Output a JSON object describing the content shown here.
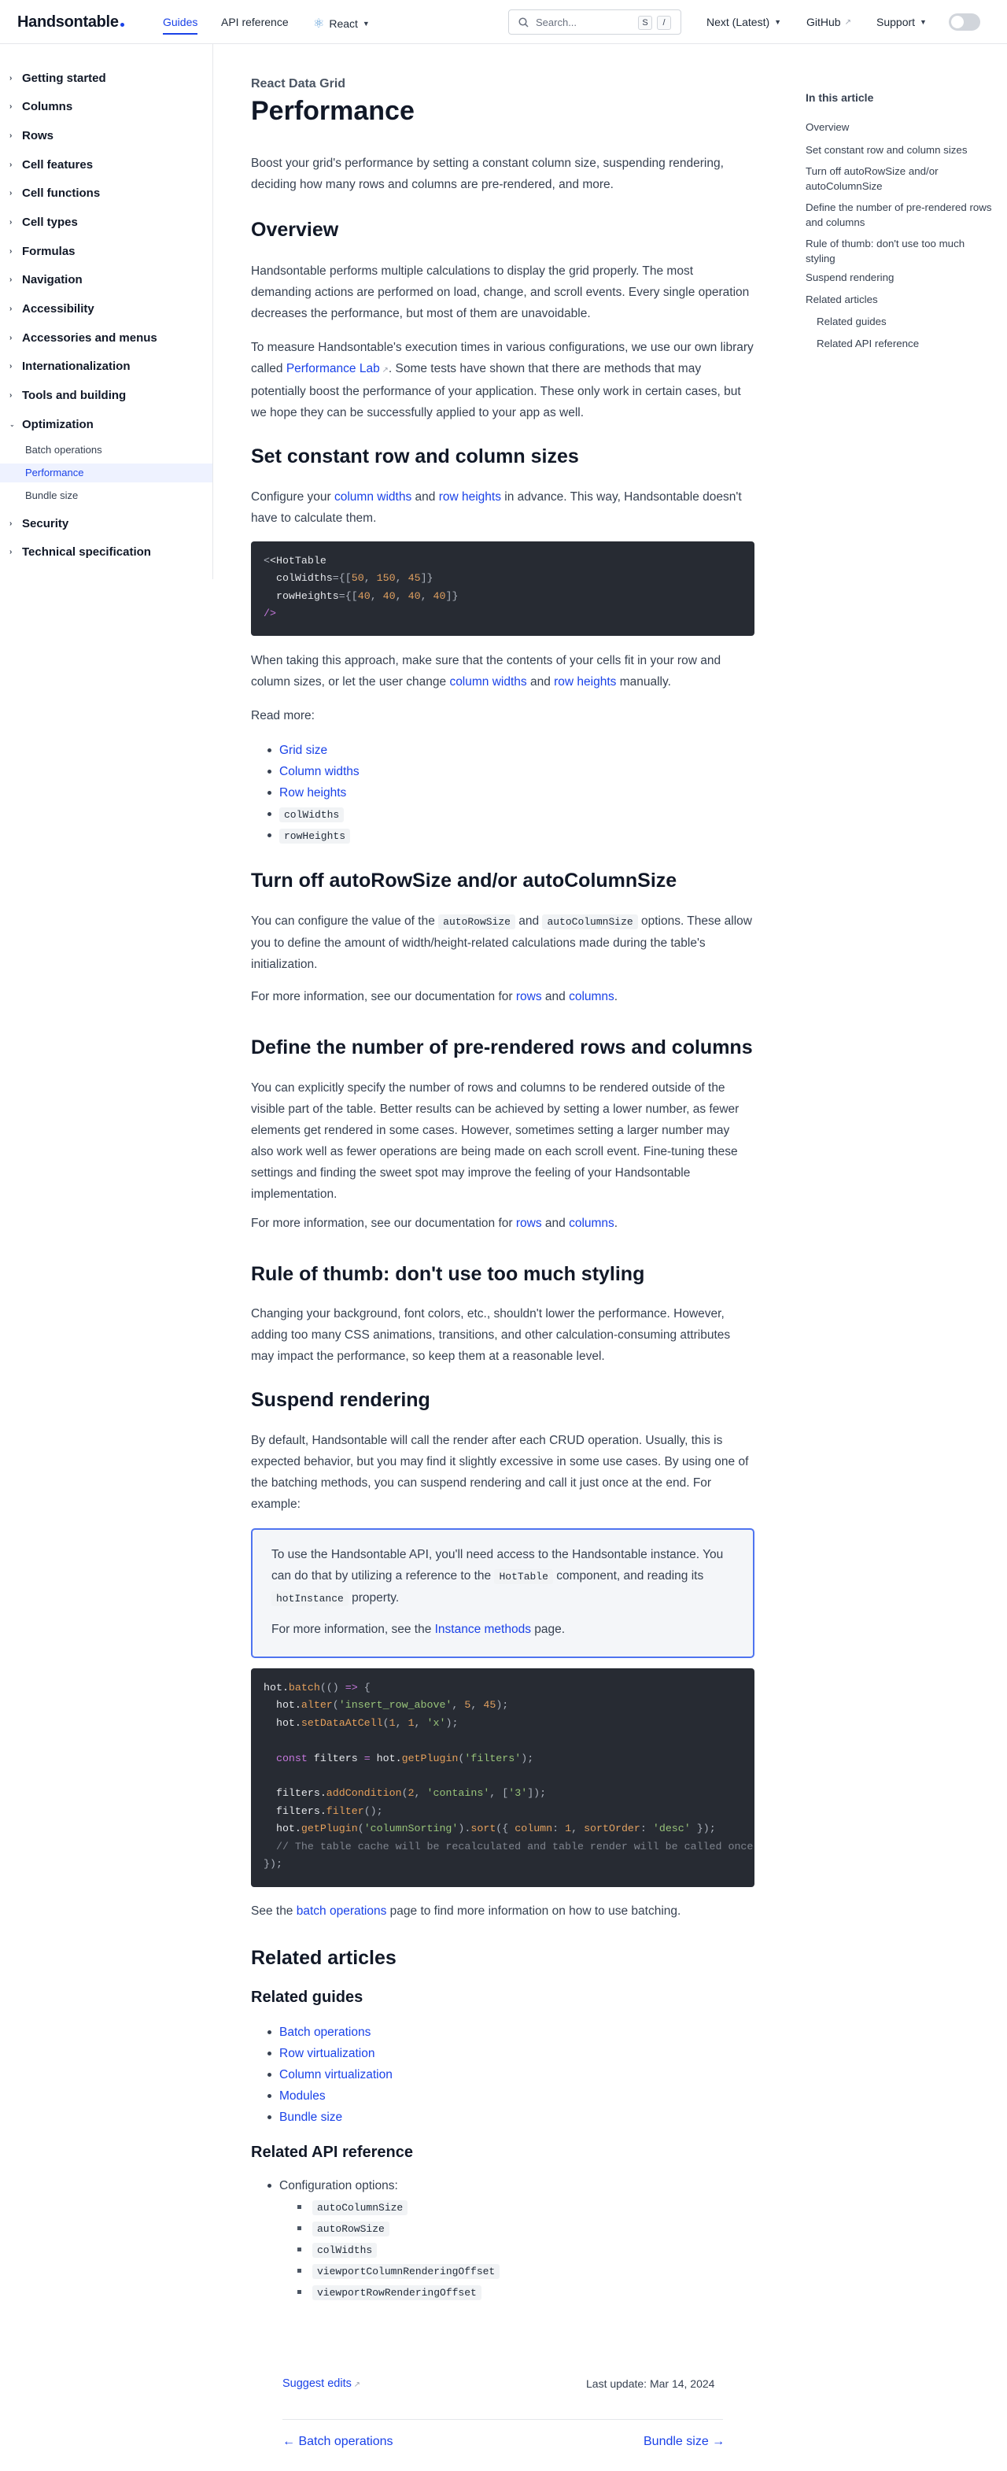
{
  "header": {
    "logo": "Handsontable",
    "nav_guides": "Guides",
    "nav_api": "API reference",
    "nav_framework": "React",
    "search_placeholder": "Search...",
    "kbd_s": "S",
    "kbd_slash": "/",
    "version": "Next (Latest)",
    "github": "GitHub",
    "support": "Support"
  },
  "sidebar": {
    "items": [
      "Getting started",
      "Columns",
      "Rows",
      "Cell features",
      "Cell functions",
      "Cell types",
      "Formulas",
      "Navigation",
      "Accessibility",
      "Accessories and menus",
      "Internationalization",
      "Tools and building",
      "Optimization",
      "Security",
      "Technical specification"
    ],
    "optimization_children": [
      "Batch operations",
      "Performance",
      "Bundle size"
    ],
    "active_child": "Performance"
  },
  "page": {
    "breadcrumb": "React Data Grid",
    "title": "Performance",
    "intro": "Boost your grid's performance by setting a constant column size, suspending rendering, deciding how many rows and columns are pre-rendered, and more.",
    "overview": {
      "heading": "Overview",
      "p1": "Handsontable performs multiple calculations to display the grid properly. The most demanding actions are performed on load, change, and scroll events. Every single operation decreases the performance, but most of them are unavoidable.",
      "p2_a": "To measure Handsontable's execution times in various configurations, we use our own library called ",
      "p2_link": "Performance Lab",
      "p2_b": ". Some tests have shown that there are methods that may potentially boost the performance of your application. These only work in certain cases, but we hope they can be successfully applied to your app as well."
    },
    "constant": {
      "heading": "Set constant row and column sizes",
      "p1_a": "Configure your ",
      "p1_link1": "column widths",
      "p1_mid": " and ",
      "p1_link2": "row heights",
      "p1_b": " in advance. This way, Handsontable doesn't have to calculate them.",
      "code_lines": [
        "<HotTable",
        "  colWidths={[50, 150, 45]}",
        "  rowHeights={[40, 40, 40, 40]}",
        "/>"
      ],
      "p2_a": "When taking this approach, make sure that the contents of your cells fit in your row and column sizes, or let the user change ",
      "p2_link1": "column widths",
      "p2_mid": " and ",
      "p2_link2": "row heights",
      "p2_b": " manually.",
      "read_more": "Read more:",
      "links": [
        "Grid size",
        "Column widths",
        "Row heights"
      ],
      "codes": [
        "colWidths",
        "rowHeights"
      ]
    },
    "autosize": {
      "heading": "Turn off autoRowSize and/or autoColumnSize",
      "p1_a": "You can configure the value of the ",
      "code1": "autoRowSize",
      "p1_mid": " and ",
      "code2": "autoColumnSize",
      "p1_b": " options. These allow you to define the amount of width/height-related calculations made during the table's initialization.",
      "p2_a": "For more information, see our documentation for ",
      "p2_link1": "rows",
      "p2_mid": " and ",
      "p2_link2": "columns",
      "p2_b": "."
    },
    "prerender": {
      "heading": "Define the number of pre-rendered rows and columns",
      "p1": "You can explicitly specify the number of rows and columns to be rendered outside of the visible part of the table. Better results can be achieved by setting a lower number, as fewer elements get rendered in some cases. However, sometimes setting a larger number may also work well as fewer operations are being made on each scroll event. Fine-tuning these settings and finding the sweet spot may improve the feeling of your Handsontable implementation.",
      "p2_a": "For more information, see our documentation for ",
      "p2_link1": "rows",
      "p2_mid": " and ",
      "p2_link2": "columns",
      "p2_b": "."
    },
    "styling": {
      "heading": "Rule of thumb: don't use too much styling",
      "p1": "Changing your background, font colors, etc., shouldn't lower the performance. However, adding too many CSS animations, transitions, and other calculation-consuming attributes may impact the performance, so keep them at a reasonable level."
    },
    "suspend": {
      "heading": "Suspend rendering",
      "p1": "By default, Handsontable will call the render after each CRUD operation. Usually, this is expected behavior, but you may find it slightly excessive in some use cases. By using one of the batching methods, you can suspend rendering and call it just once at the end. For example:",
      "note_a": "To use the Handsontable API, you'll need access to the Handsontable instance. You can do that by utilizing a reference to the ",
      "note_code1": "HotTable",
      "note_b": " component, and reading its ",
      "note_code2": "hotInstance",
      "note_c": " property.",
      "note2_a": "For more information, see the ",
      "note2_link": "Instance methods",
      "note2_b": " page.",
      "p2_a": "See the ",
      "p2_link": "batch operations",
      "p2_b": " page to find more information on how to use batching."
    },
    "related": {
      "heading": "Related articles",
      "guides_heading": "Related guides",
      "guides": [
        "Batch operations",
        "Row virtualization",
        "Column virtualization",
        "Modules",
        "Bundle size"
      ],
      "api_heading": "Related API reference",
      "config_label": "Configuration options:",
      "config": [
        "autoColumnSize",
        "autoRowSize",
        "colWidths",
        "viewportColumnRenderingOffset",
        "viewportRowRenderingOffset"
      ]
    }
  },
  "toc": {
    "title": "In this article",
    "items": [
      "Overview",
      "Set constant row and column sizes",
      "Turn off autoRowSize and/or autoColumnSize",
      "Define the number of pre-rendered rows and columns",
      "Rule of thumb: don't use too much styling",
      "Suspend rendering",
      "Related articles",
      "Related guides",
      "Related API reference"
    ]
  },
  "footer": {
    "suggest": "Suggest edits",
    "last_update": "Last update: Mar 14, 2024",
    "prev": "Batch operations",
    "next": "Bundle size"
  },
  "colors": {
    "accent": "#1a42e8",
    "code_bg": "#272b33",
    "note_border": "#4f74f0"
  }
}
